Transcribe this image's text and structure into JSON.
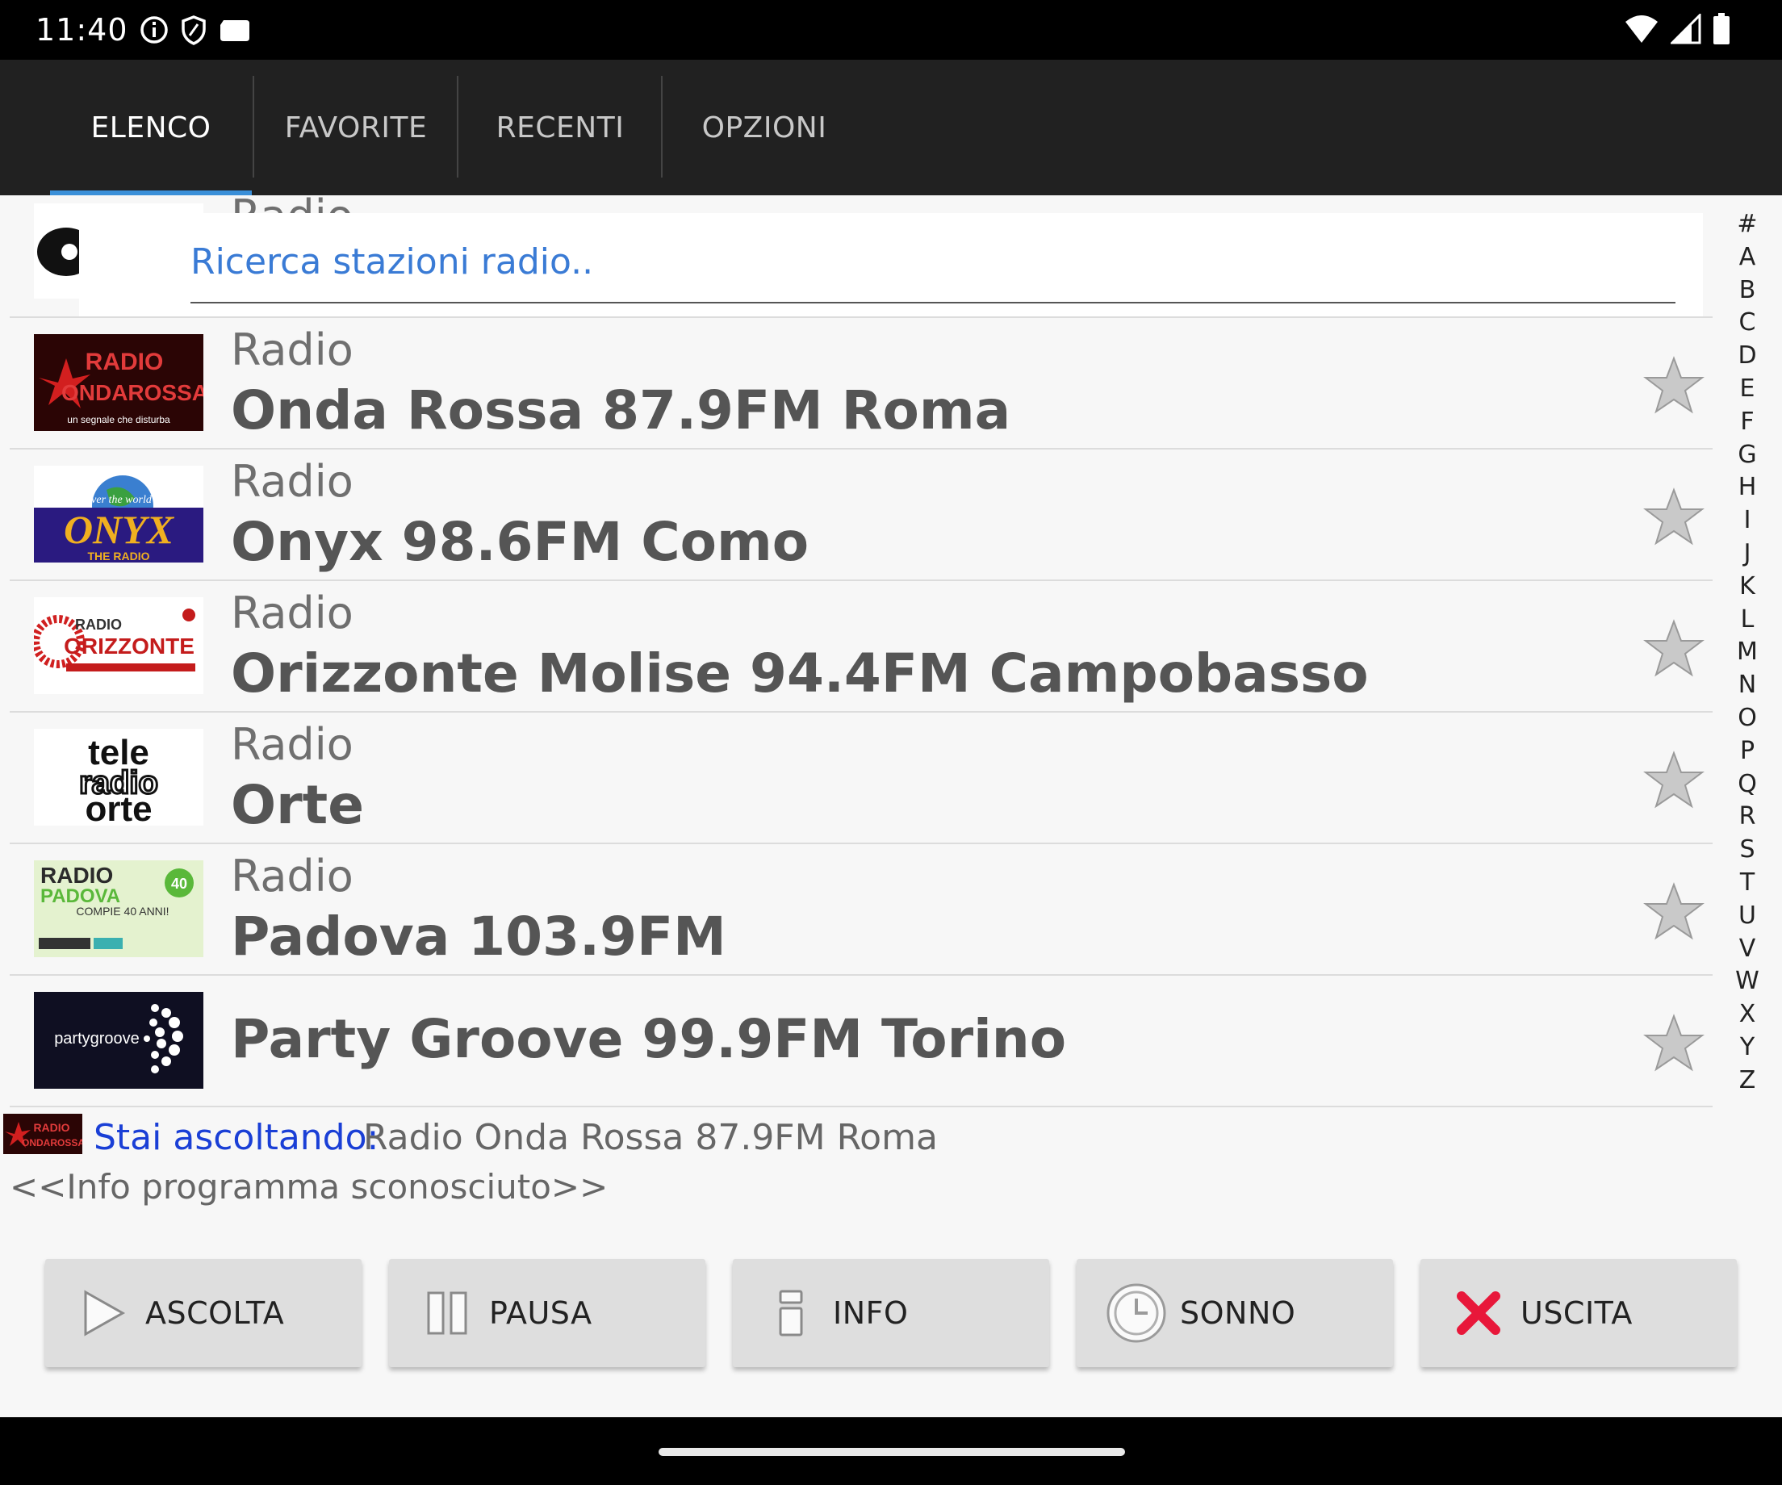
{
  "status_bar": {
    "time": "11:40"
  },
  "tabs": [
    {
      "label": "ELENCO",
      "active": true
    },
    {
      "label": "FAVORITE",
      "active": false
    },
    {
      "label": "RECENTI",
      "active": false
    },
    {
      "label": "OPZIONI",
      "active": false
    }
  ],
  "search": {
    "placeholder": "Ricerca stazioni radio..",
    "value": ""
  },
  "partial_row": {
    "line1": "Radio"
  },
  "stations": [
    {
      "line1": "Radio",
      "line2": "Onda Rossa 87.9FM Roma"
    },
    {
      "line1": "Radio",
      "line2": "Onyx 98.6FM Como"
    },
    {
      "line1": "Radio",
      "line2": "Orizzonte Molise 94.4FM Campobasso"
    },
    {
      "line1": "Radio",
      "line2": "Orte"
    },
    {
      "line1": "Radio",
      "line2": "Padova 103.9FM"
    },
    {
      "line1": "",
      "line2": "Party Groove 99.9FM Torino"
    }
  ],
  "logos": {
    "onda_rossa": [
      "RADIO",
      "ONDAROSSA",
      "un segnale che disturba"
    ],
    "onyx": [
      "over the world",
      "ONYX",
      "THE RADIO"
    ],
    "orizzonte": [
      "RADIO",
      "ORIZZONTE"
    ],
    "orte": [
      "tele",
      "radio",
      "orte"
    ],
    "padova": [
      "RADIO",
      "PADOVA",
      "COMPIE 40 ANNI!",
      "40"
    ],
    "party": "partygroove"
  },
  "alphabet": [
    "#",
    "A",
    "B",
    "C",
    "D",
    "E",
    "F",
    "G",
    "H",
    "I",
    "J",
    "K",
    "L",
    "M",
    "N",
    "O",
    "P",
    "Q",
    "R",
    "S",
    "T",
    "U",
    "V",
    "W",
    "X",
    "Y",
    "Z"
  ],
  "now_playing": {
    "prefix": "Stai ascoltando:",
    "station": "Radio Onda Rossa 87.9FM Roma",
    "info": "<<Info programma sconosciuto>>"
  },
  "buttons": {
    "play": "ASCOLTA",
    "pause": "PAUSA",
    "info": "INFO",
    "sleep": "SONNO",
    "exit": "USCITA"
  },
  "colors": {
    "tab_bar": "#212121",
    "tab_indicator": "#3a8fd8",
    "search_text": "#3a7bd5",
    "now_playing_prefix": "#1a3fd6",
    "exit_icon": "#e8173a"
  }
}
